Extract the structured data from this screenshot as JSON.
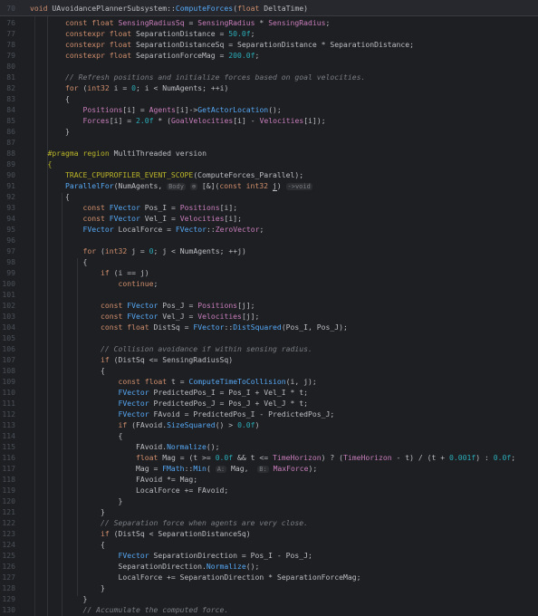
{
  "sticky": {
    "line": "70",
    "text": "void UAvoidancePlannerSubsystem::ComputeForces(float DeltaTime)"
  },
  "lines": [
    {
      "n": "76",
      "html": "        <span class='kw'>const</span> <span class='kw'>float</span> <span class='mb'>SensingRadiusSq</span> = <span class='mb'>SensingRadius</span> * <span class='mb'>SensingRadius</span>;"
    },
    {
      "n": "77",
      "html": "        <span class='kw'>constexpr</span> <span class='kw'>float</span> SeparationDistance = <span class='nm'>50.0f</span>;"
    },
    {
      "n": "78",
      "html": "        <span class='kw'>constexpr</span> <span class='kw'>float</span> SeparationDistanceSq = SeparationDistance * SeparationDistance;"
    },
    {
      "n": "79",
      "html": "        <span class='kw'>constexpr</span> <span class='kw'>float</span> SeparationForceMag = <span class='nm'>200.0f</span>;"
    },
    {
      "n": "80",
      "html": ""
    },
    {
      "n": "81",
      "html": "        <span class='cm'>// Refresh positions and initialize forces based on goal velocities.</span>"
    },
    {
      "n": "82",
      "html": "        <span class='kw'>for</span> (<span class='kw'>int32</span> i = <span class='nm'>0</span>; i &lt; NumAgents; ++i)"
    },
    {
      "n": "83",
      "html": "        {"
    },
    {
      "n": "84",
      "html": "            <span class='mb'>Positions</span>[i] = <span class='mb'>Agents</span>[i]-&gt;<span class='fn'>GetActorLocation</span>();"
    },
    {
      "n": "85",
      "html": "            <span class='mb'>Forces</span>[i] = <span class='nm'>2.0f</span> * (<span class='mb'>GoalVelocities</span>[i] - <span class='mb'>Velocities</span>[i]);"
    },
    {
      "n": "86",
      "html": "        }"
    },
    {
      "n": "87",
      "html": ""
    },
    {
      "n": "88",
      "html": "    <span class='pp'>#pragma region</span> MultiThreaded version"
    },
    {
      "n": "89",
      "html": "    <span class='pp'>{</span>"
    },
    {
      "n": "90",
      "html": "        <span class='pp'>TRACE_CPUPROFILER_EVENT_SCOPE</span>(ComputeForces_Parallel);"
    },
    {
      "n": "91",
      "html": "        <span class='fn'>ParallelFor</span>(NumAgents, <span class='hint'>Body</span> <span class='hint'>⊕</span> [&amp;](<span class='kw'>const</span> <span class='kw'>int32</span> <span class='caret'>j</span>) <span class='hint'>-&gt;void</span>"
    },
    {
      "n": "92",
      "html": "        {"
    },
    {
      "n": "93",
      "html": "            <span class='kw'>const</span> <span class='ty'>FVector</span> Pos_I = <span class='mb'>Positions</span>[i];"
    },
    {
      "n": "94",
      "html": "            <span class='kw'>const</span> <span class='ty'>FVector</span> Vel_I = <span class='mb'>Velocities</span>[i];"
    },
    {
      "n": "95",
      "html": "            <span class='ty'>FVector</span> LocalForce = <span class='ty'>FVector</span>::<span class='mb'>ZeroVector</span>;"
    },
    {
      "n": "96",
      "html": ""
    },
    {
      "n": "97",
      "html": "            <span class='kw'>for</span> (<span class='kw'>int32</span> j = <span class='nm'>0</span>; j &lt; NumAgents; ++j)"
    },
    {
      "n": "98",
      "html": "            {"
    },
    {
      "n": "99",
      "html": "                <span class='kw'>if</span> (i == j)"
    },
    {
      "n": "100",
      "html": "                    <span class='kw'>continue</span>;"
    },
    {
      "n": "101",
      "html": ""
    },
    {
      "n": "102",
      "html": "                <span class='kw'>const</span> <span class='ty'>FVector</span> Pos_J = <span class='mb'>Positions</span>[j];"
    },
    {
      "n": "103",
      "html": "                <span class='kw'>const</span> <span class='ty'>FVector</span> Vel_J = <span class='mb'>Velocities</span>[j];"
    },
    {
      "n": "104",
      "html": "                <span class='kw'>const</span> <span class='kw'>float</span> DistSq = <span class='ty'>FVector</span>::<span class='fn'>DistSquared</span>(Pos_I, Pos_J);"
    },
    {
      "n": "105",
      "html": ""
    },
    {
      "n": "106",
      "html": "                <span class='cm'>// Collision avoidance if within sensing radius.</span>"
    },
    {
      "n": "107",
      "html": "                <span class='kw'>if</span> (DistSq &lt;= SensingRadiusSq)"
    },
    {
      "n": "108",
      "html": "                {"
    },
    {
      "n": "109",
      "html": "                    <span class='kw'>const</span> <span class='kw'>float</span> t = <span class='fn'>ComputeTimeToCollision</span>(i, j);"
    },
    {
      "n": "110",
      "html": "                    <span class='ty'>FVector</span> PredictedPos_I = Pos_I + Vel_I * t;"
    },
    {
      "n": "111",
      "html": "                    <span class='ty'>FVector</span> PredictedPos_J = Pos_J + Vel_J * t;"
    },
    {
      "n": "112",
      "html": "                    <span class='ty'>FVector</span> FAvoid = PredictedPos_I - PredictedPos_J;"
    },
    {
      "n": "113",
      "html": "                    <span class='kw'>if</span> (FAvoid.<span class='fn'>SizeSquared</span>() &gt; <span class='nm'>0.0f</span>)"
    },
    {
      "n": "114",
      "html": "                    {"
    },
    {
      "n": "115",
      "html": "                        FAvoid.<span class='fn'>Normalize</span>();"
    },
    {
      "n": "116",
      "html": "                        <span class='kw'>float</span> Mag = (t &gt;= <span class='nm'>0.0f</span> &amp;&amp; t &lt;= <span class='mb'>TimeHorizon</span>) ? (<span class='mb'>TimeHorizon</span> - t) / (t + <span class='nm'>0.001f</span>) : <span class='nm'>0.0f</span>;"
    },
    {
      "n": "117",
      "html": "                        Mag = <span class='ty'>FMath</span>::<span class='fn'>Min</span>( <span class='hint'>A:</span> Mag,  <span class='hint'>B:</span> <span class='mb'>MaxForce</span>);"
    },
    {
      "n": "118",
      "html": "                        FAvoid *= Mag;"
    },
    {
      "n": "119",
      "html": "                        LocalForce += FAvoid;"
    },
    {
      "n": "120",
      "html": "                    }"
    },
    {
      "n": "121",
      "html": "                }"
    },
    {
      "n": "122",
      "html": "                <span class='cm'>// Separation force when agents are very close.</span>"
    },
    {
      "n": "123",
      "html": "                <span class='kw'>if</span> (DistSq &lt; SeparationDistanceSq)"
    },
    {
      "n": "124",
      "html": "                {"
    },
    {
      "n": "125",
      "html": "                    <span class='ty'>FVector</span> SeparationDirection = Pos_I - Pos_J;"
    },
    {
      "n": "126",
      "html": "                    SeparationDirection.<span class='fn'>Normalize</span>();"
    },
    {
      "n": "127",
      "html": "                    LocalForce += SeparationDirection * SeparationForceMag;"
    },
    {
      "n": "128",
      "html": "                }"
    },
    {
      "n": "129",
      "html": "            }"
    },
    {
      "n": "130",
      "html": "            <span class='cm'>// Accumulate the computed force.</span>"
    }
  ]
}
